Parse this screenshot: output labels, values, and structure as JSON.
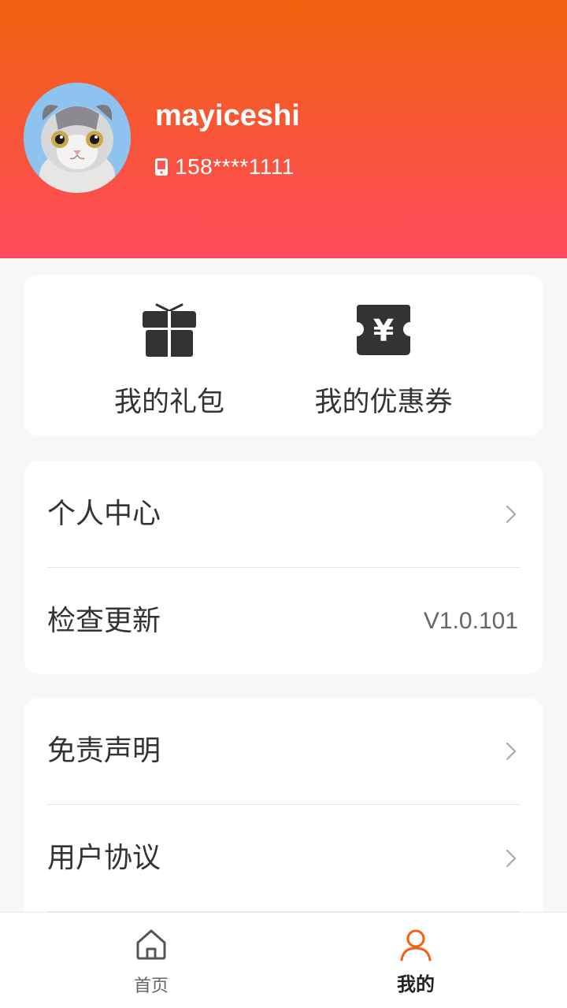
{
  "profile": {
    "username": "mayiceshi",
    "phone": "158****1111",
    "avatar_icon": "cat-avatar"
  },
  "quick_actions": [
    {
      "label": "我的礼包",
      "icon": "gift-icon"
    },
    {
      "label": "我的优惠券",
      "icon": "coupon-icon"
    }
  ],
  "menu_group_1": [
    {
      "label": "个人中心",
      "icon": "chevron-right-icon"
    },
    {
      "label": "检查更新",
      "value": "V1.0.101"
    }
  ],
  "menu_group_2": [
    {
      "label": "免责声明",
      "icon": "chevron-right-icon"
    },
    {
      "label": "用户协议",
      "icon": "chevron-right-icon"
    }
  ],
  "tabbar": {
    "home_label": "首页",
    "mine_label": "我的",
    "active_color": "#f0620f"
  },
  "colors": {
    "header_gradient_top": "#f0620f",
    "header_gradient_bottom": "#ff4a5d"
  }
}
